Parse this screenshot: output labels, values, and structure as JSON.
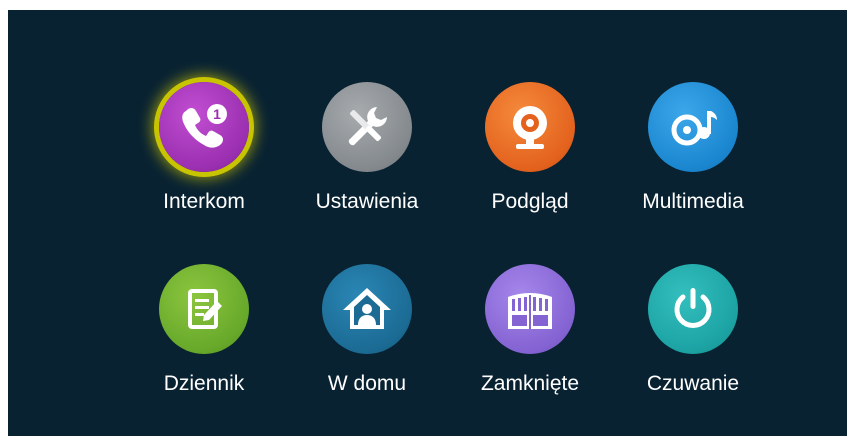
{
  "menu": {
    "items": [
      {
        "label": "Interkom",
        "icon": "phone-icon",
        "badge": "1",
        "color": "#a63fb5",
        "selected": true
      },
      {
        "label": "Ustawienia",
        "icon": "tools-icon",
        "color": "#8a8f93"
      },
      {
        "label": "Podgląd",
        "icon": "webcam-icon",
        "color": "#e96a22"
      },
      {
        "label": "Multimedia",
        "icon": "music-note-icon",
        "color": "#1e8fd6"
      },
      {
        "label": "Dziennik",
        "icon": "notepad-icon",
        "color": "#6fad2e"
      },
      {
        "label": "W domu",
        "icon": "home-person-icon",
        "color": "#1c6c95"
      },
      {
        "label": "Zamknięte",
        "icon": "gate-icon",
        "color": "#8b6ad6"
      },
      {
        "label": "Czuwanie",
        "icon": "power-icon",
        "color": "#1ea7a7"
      }
    ]
  },
  "colors": {
    "background": "#092232",
    "selection_glow": "#c9c400"
  }
}
